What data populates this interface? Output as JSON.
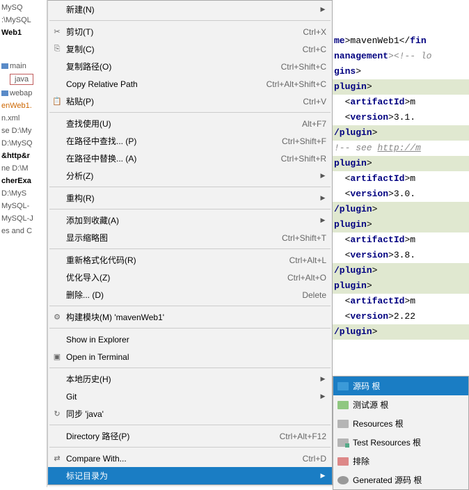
{
  "tree": {
    "items": [
      " MySQ",
      ":\\MySQL",
      "Web1",
      "main",
      "java",
      "webap",
      "enWeb1.",
      "n.xml",
      "se  D:\\My",
      "D:\\MySQ",
      "&http&r",
      "ne  D:\\M",
      "cherExa",
      "D:\\MyS",
      "MySQL-",
      "MySQL-J",
      "es and C"
    ]
  },
  "menu": {
    "new": "新建(N)",
    "cut": "剪切(T)",
    "cut_sc": "Ctrl+X",
    "copy": "复制(C)",
    "copy_sc": "Ctrl+C",
    "copy_path": "复制路径(O)",
    "copy_path_sc": "Ctrl+Shift+C",
    "copy_rel": "Copy Relative Path",
    "copy_rel_sc": "Ctrl+Alt+Shift+C",
    "paste": "粘贴(P)",
    "paste_sc": "Ctrl+V",
    "find_usages": "查找使用(U)",
    "find_usages_sc": "Alt+F7",
    "find_in_path": "在路径中查找... (P)",
    "find_in_path_sc": "Ctrl+Shift+F",
    "replace_in_path": "在路径中替换... (A)",
    "replace_in_path_sc": "Ctrl+Shift+R",
    "analyze": "分析(Z)",
    "refactor": "重构(R)",
    "add_fav": "添加到收藏(A)",
    "show_thumb": "显示缩略图",
    "show_thumb_sc": "Ctrl+Shift+T",
    "reformat": "重新格式化代码(R)",
    "reformat_sc": "Ctrl+Alt+L",
    "optimize": "优化导入(Z)",
    "optimize_sc": "Ctrl+Alt+O",
    "delete": "删除... (D)",
    "delete_sc": "Delete",
    "build_module": "构建模块(M) 'mavenWeb1'",
    "show_explorer": "Show in Explorer",
    "open_terminal": "Open in Terminal",
    "local_history": "本地历史(H)",
    "git": "Git",
    "sync": "同步 'java'",
    "directory_path": "Directory 路径(P)",
    "directory_path_sc": "Ctrl+Alt+F12",
    "compare": "Compare With...",
    "compare_sc": "Ctrl+D",
    "mark_dir": "标记目录为"
  },
  "submenu": {
    "sources": "源码 根",
    "test_sources": "测试源 根",
    "resources": "Resources 根",
    "test_resources": "Test Resources 根",
    "excluded": "排除",
    "generated": "Generated 源码 根"
  },
  "code": {
    "l1a": "me",
    "l1b": ">mavenWeb1</",
    "l1c": "fin",
    "l2a": "nanagement",
    "l2b": "><!-- lo",
    "l3": "gins",
    "l3b": ">",
    "l4": "plugin",
    "l4b": ">",
    "l5a": "<",
    "l5b": "artifactId",
    "l5c": ">m",
    "l6a": "<",
    "l6b": "version",
    "l6c": ">3.1.",
    "l7": "/plugin",
    "l7b": ">",
    "l8a": "!-- see ",
    "l8b": "http://m",
    "l9": "plugin",
    "l9b": ">",
    "l10c": ">3.0.",
    "l13c": ">3.8.",
    "l16c": ">2.22"
  }
}
